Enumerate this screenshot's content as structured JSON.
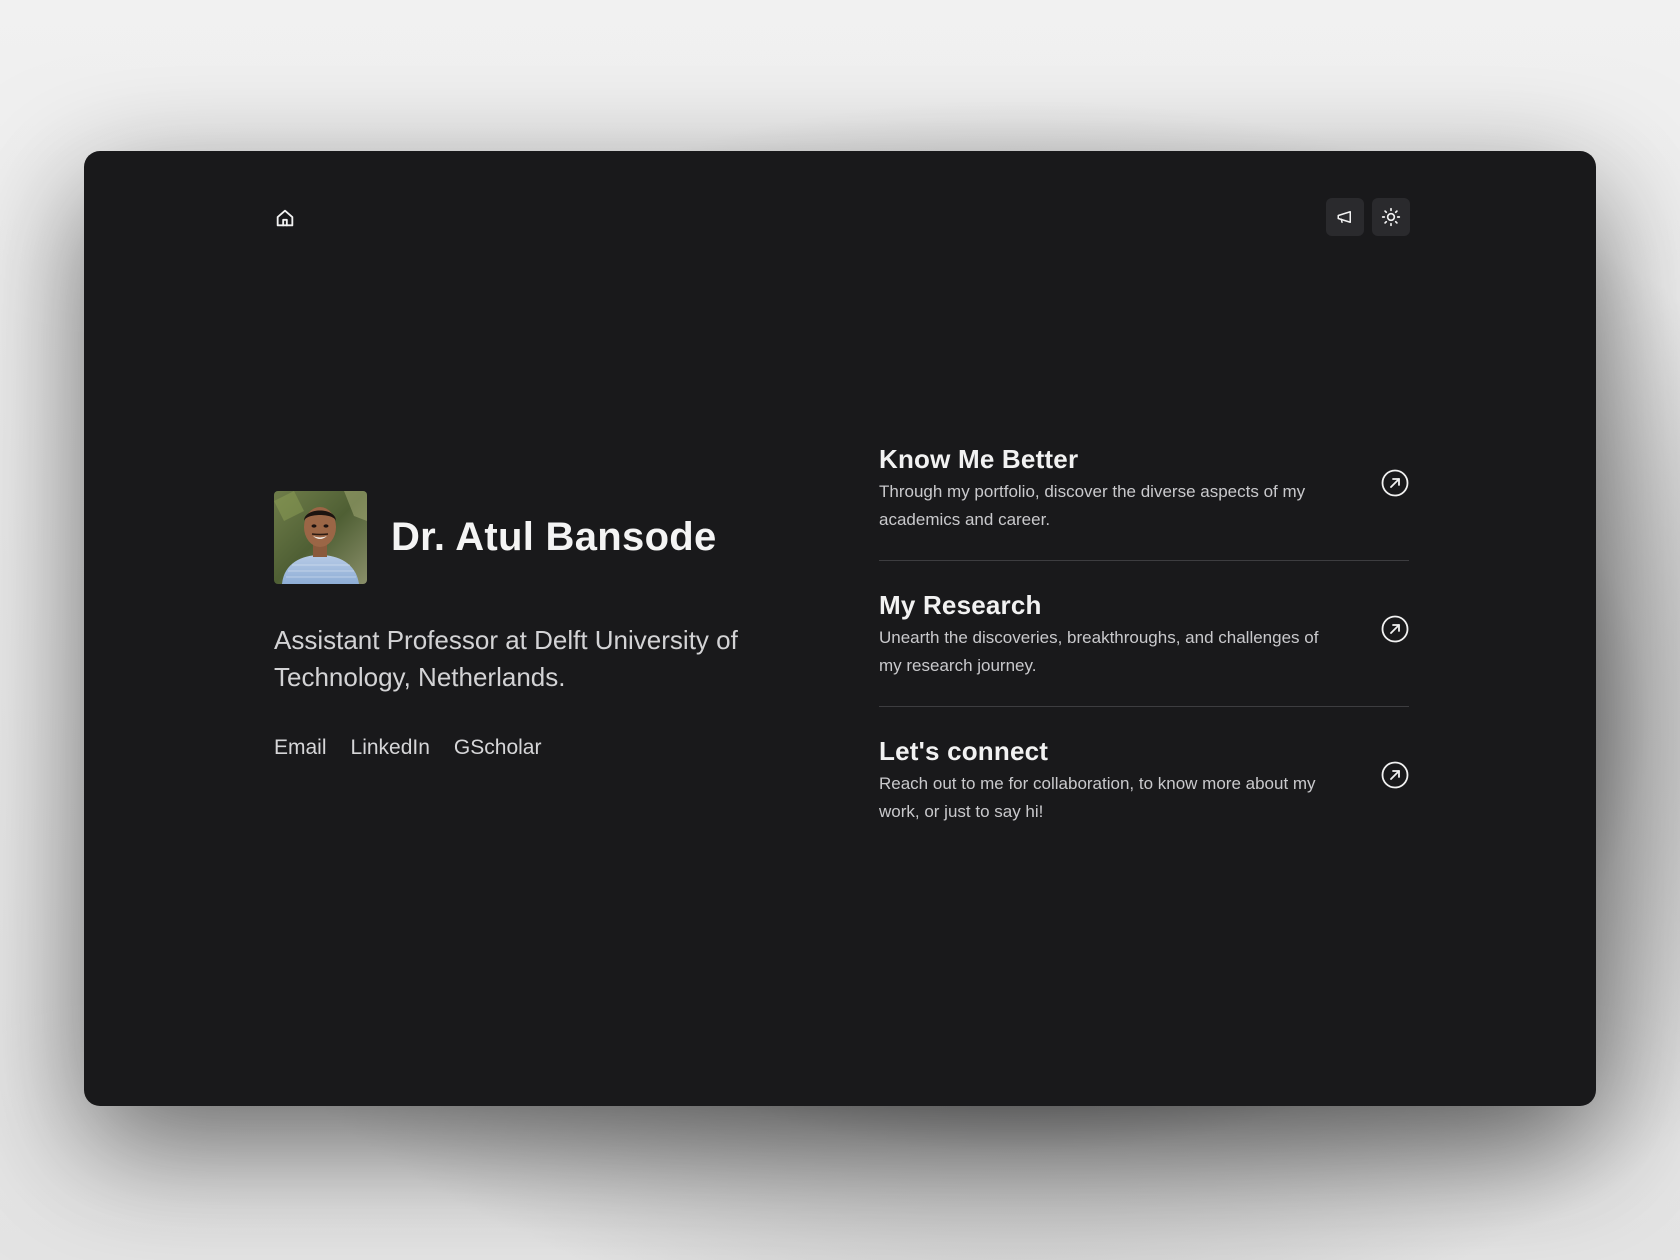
{
  "nav": {
    "home_icon": "home-icon",
    "announce_icon": "megaphone-icon",
    "theme_icon": "sun-icon"
  },
  "profile": {
    "name": "Dr. Atul Bansode",
    "subtitle": "Assistant Professor at Delft University of Technology, Netherlands.",
    "links": {
      "email": "Email",
      "linkedin": "LinkedIn",
      "gscholar": "GScholar"
    }
  },
  "cards": [
    {
      "title": "Know Me Better",
      "description": "Through my portfolio, discover the diverse aspects of my academics and career."
    },
    {
      "title": "My Research",
      "description": "Unearth the discoveries, breakthroughs, and challenges of my research journey."
    },
    {
      "title": "Let's connect",
      "description": "Reach out to me for collaboration, to know more about my work, or just to say hi!"
    }
  ],
  "colors": {
    "background": "#19191b",
    "text_primary": "#f4f4f4",
    "text_secondary": "#c9c9cc",
    "divider": "#3d3d40",
    "button_bg": "#2a2a2d"
  }
}
